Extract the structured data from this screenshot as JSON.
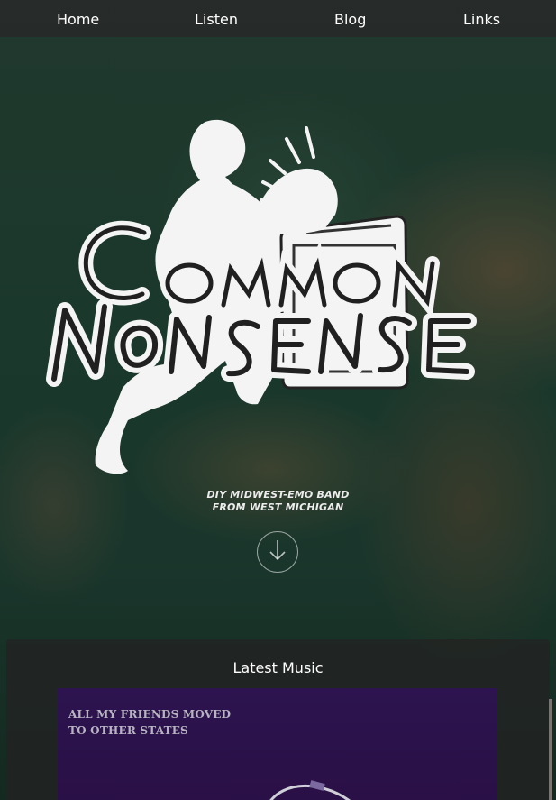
{
  "nav": {
    "items": [
      {
        "label": "Home"
      },
      {
        "label": "Listen"
      },
      {
        "label": "Blog"
      },
      {
        "label": "Links"
      }
    ]
  },
  "hero": {
    "logo_text": "Common Nonsense",
    "tagline_line1": "DIY MIDWEST-EMO BAND",
    "tagline_line2": "FROM WEST MICHIGAN",
    "scroll_icon": "arrow-down-circle-icon"
  },
  "latest_music": {
    "title": "Latest Music",
    "album_text": "ALL MY FRIENDS MOVED\nTO OTHER STATES"
  },
  "colors": {
    "nav_bg": "#282828",
    "album_bg": "#2d1450",
    "album_text": "#b7b3c1",
    "hero_tint": "#1f3a2e"
  }
}
